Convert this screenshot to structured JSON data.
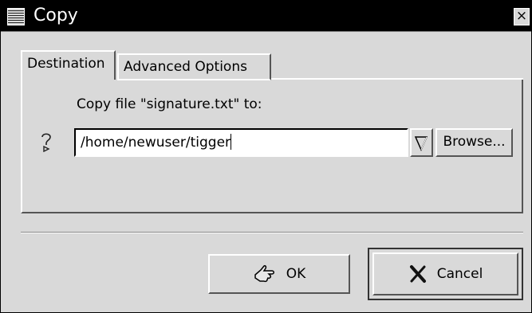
{
  "window": {
    "title": "Copy",
    "close_glyph": "×"
  },
  "tabs": [
    {
      "label": "Destination",
      "active": true
    },
    {
      "label": "Advanced Options",
      "active": false
    }
  ],
  "destination": {
    "prompt": "Copy file \"signature.txt\" to:",
    "path_value": "/home/newuser/tigger",
    "help_icon": "question-mark-icon",
    "browse_label": "Browse..."
  },
  "buttons": {
    "ok_label": "OK",
    "ok_icon": "ok-hand-icon",
    "cancel_label": "Cancel",
    "cancel_icon": "x-mark-icon"
  }
}
